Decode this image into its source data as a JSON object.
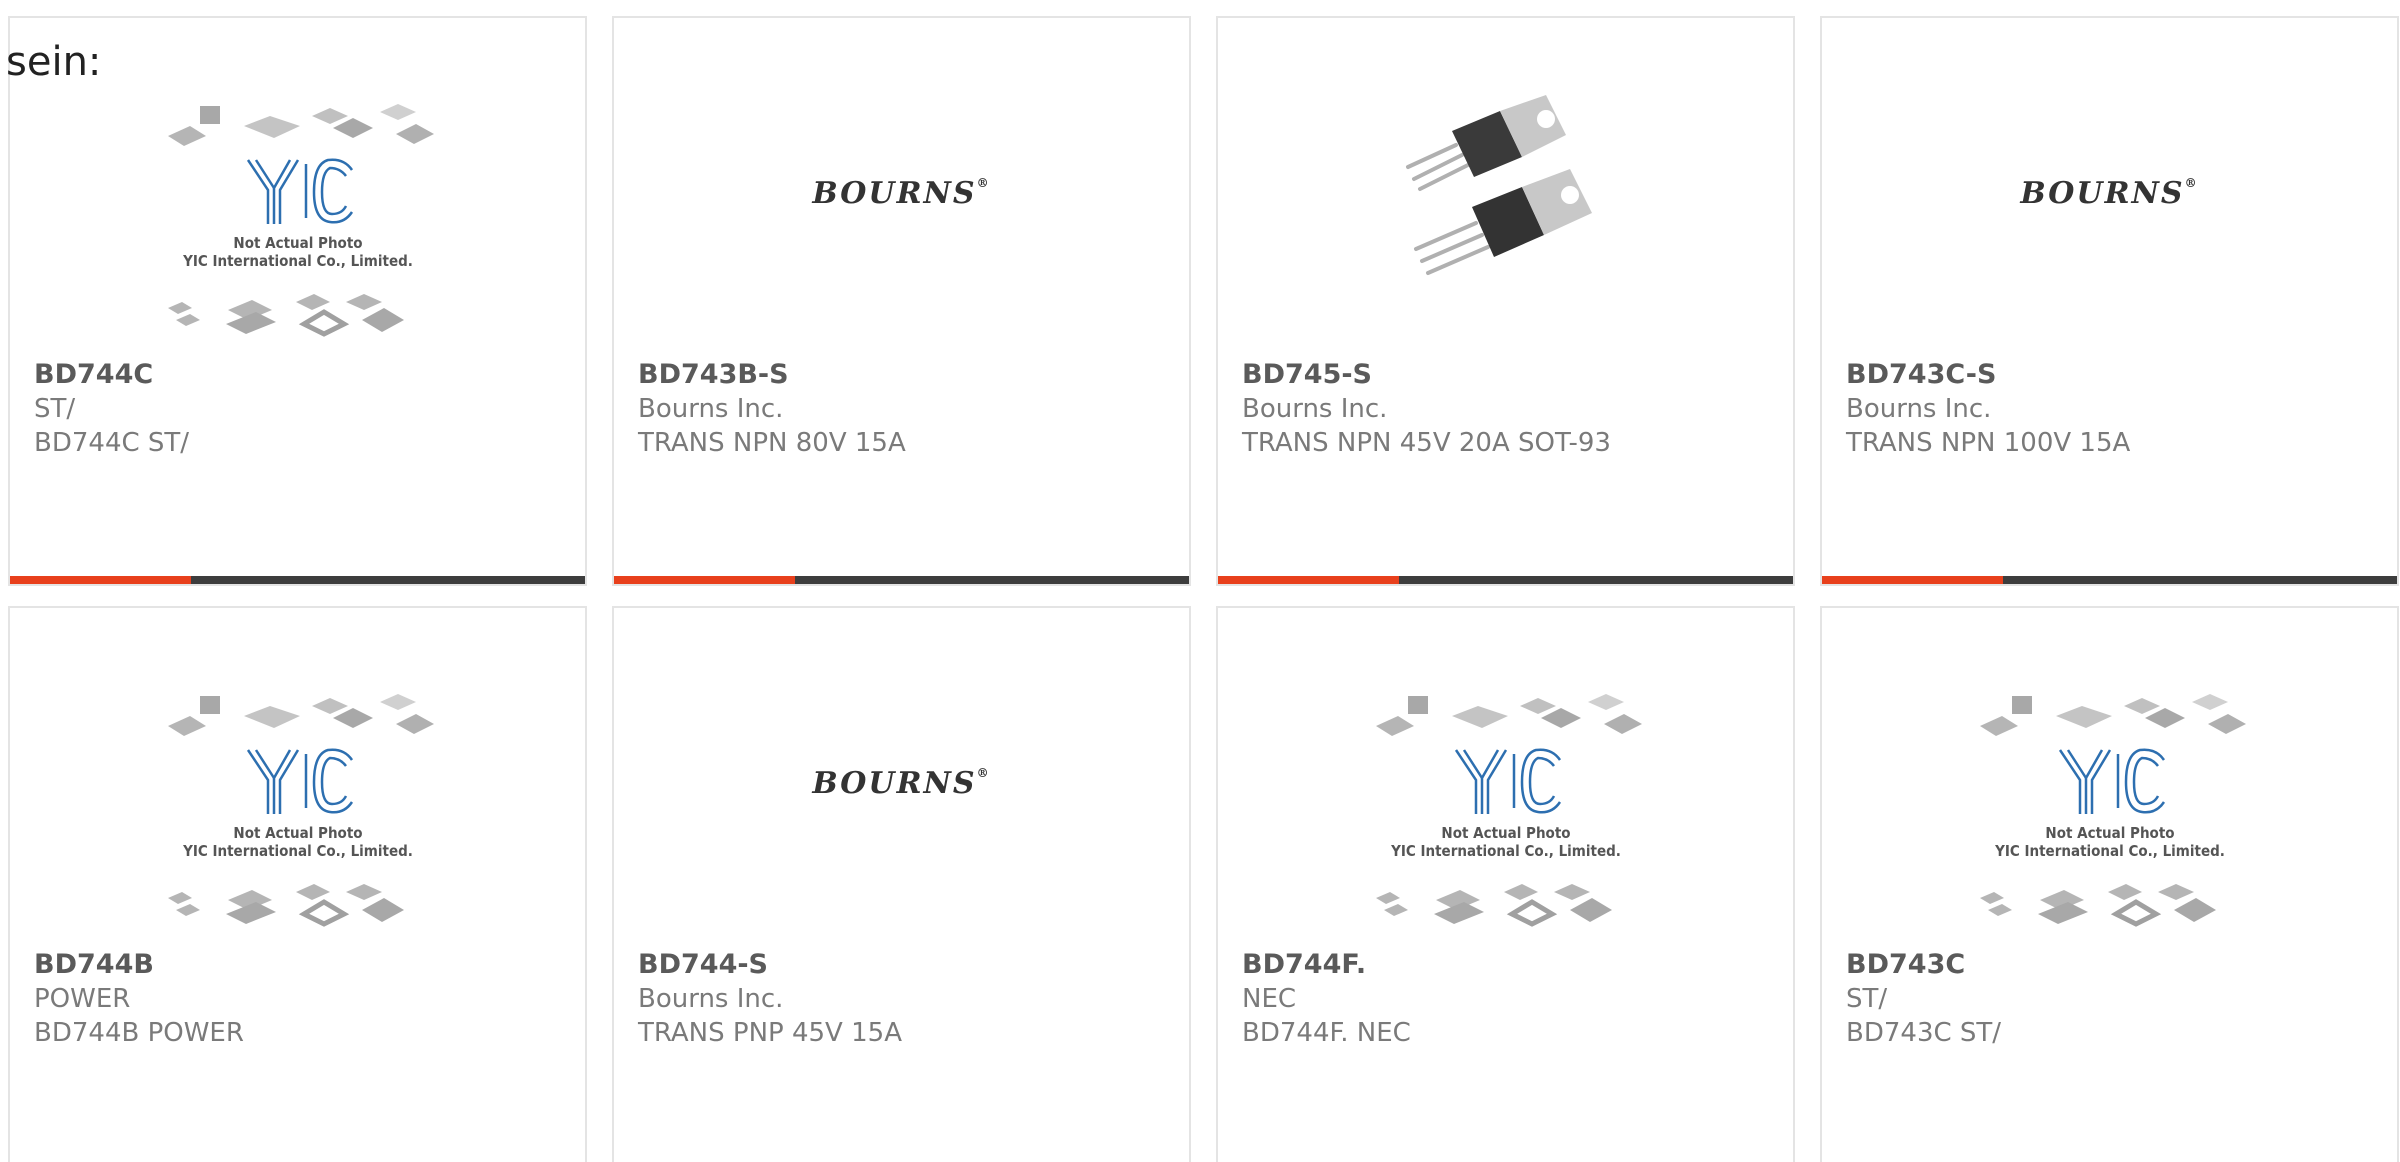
{
  "intro_text": "sein:",
  "colors": {
    "accent": "#e8401c",
    "bar": "#3d3d3d",
    "yic_blue": "#2d6fb0"
  },
  "placeholder": {
    "line1": "Not Actual Photo",
    "line2": "YIC International Co., Limited."
  },
  "brand_logo": "BOURNS",
  "products": [
    {
      "pn": "BD744C",
      "mfr": "ST/",
      "desc": "BD744C ST/",
      "image": "yic-placeholder"
    },
    {
      "pn": "BD743B-S",
      "mfr": "Bourns Inc.",
      "desc": "TRANS NPN 80V 15A",
      "image": "bourns-logo"
    },
    {
      "pn": "BD745-S",
      "mfr": "Bourns Inc.",
      "desc": "TRANS NPN 45V 20A SOT-93",
      "image": "to220-photo"
    },
    {
      "pn": "BD743C-S",
      "mfr": "Bourns Inc.",
      "desc": "TRANS NPN 100V 15A",
      "image": "bourns-logo"
    },
    {
      "pn": "BD744B",
      "mfr": "POWER",
      "desc": "BD744B POWER",
      "image": "yic-placeholder"
    },
    {
      "pn": "BD744-S",
      "mfr": "Bourns Inc.",
      "desc": "TRANS PNP 45V 15A",
      "image": "bourns-logo"
    },
    {
      "pn": "BD744F.",
      "mfr": "NEC",
      "desc": "BD744F. NEC",
      "image": "yic-placeholder"
    },
    {
      "pn": "BD743C",
      "mfr": "ST/",
      "desc": "BD743C ST/",
      "image": "yic-placeholder"
    }
  ]
}
